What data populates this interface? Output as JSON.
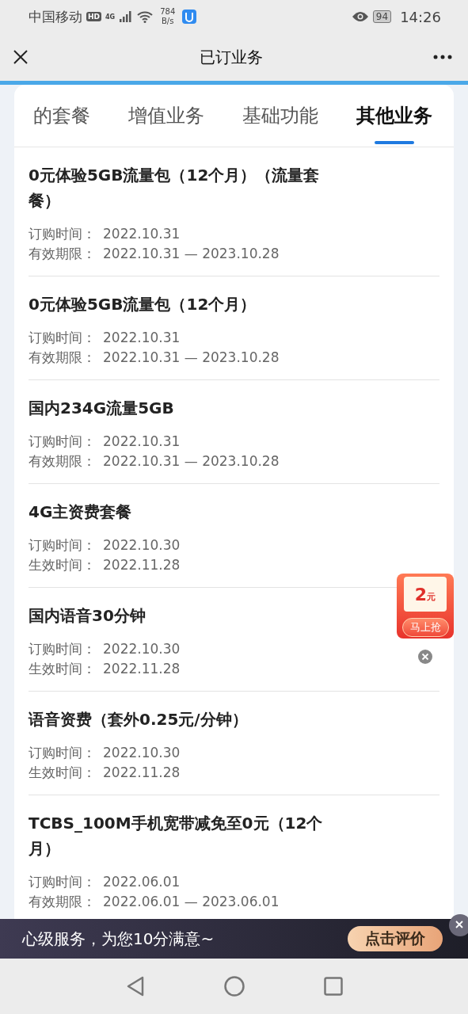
{
  "status_bar": {
    "carrier": "中国移动",
    "hd": "HD",
    "network": "4G",
    "speed_value": "784",
    "speed_unit": "B/s",
    "battery": "94",
    "time": "14:26"
  },
  "header": {
    "title": "已订业务"
  },
  "tabs": [
    {
      "label": "的套餐",
      "selected": false
    },
    {
      "label": "增值业务",
      "selected": false
    },
    {
      "label": "基础功能",
      "selected": false
    },
    {
      "label": "其他业务",
      "selected": true
    }
  ],
  "items": [
    {
      "title": "0元体验5GB流量包（12个月）（流量套餐）",
      "rows": [
        {
          "label": "订购时间：",
          "value": "2022.10.31"
        },
        {
          "label": "有效期限：",
          "value": "2022.10.31 — 2023.10.28"
        }
      ]
    },
    {
      "title": "0元体验5GB流量包（12个月）",
      "rows": [
        {
          "label": "订购时间：",
          "value": "2022.10.31"
        },
        {
          "label": "有效期限：",
          "value": "2022.10.31 — 2023.10.28"
        }
      ]
    },
    {
      "title": "国内234G流量5GB",
      "rows": [
        {
          "label": "订购时间：",
          "value": "2022.10.31"
        },
        {
          "label": "有效期限：",
          "value": "2022.10.31 — 2023.10.28"
        }
      ]
    },
    {
      "title": "4G主资费套餐",
      "rows": [
        {
          "label": "订购时间：",
          "value": "2022.10.30"
        },
        {
          "label": "生效时间：",
          "value": "2022.11.28"
        }
      ]
    },
    {
      "title": "国内语音30分钟",
      "rows": [
        {
          "label": "订购时间：",
          "value": "2022.10.30"
        },
        {
          "label": "生效时间：",
          "value": "2022.11.28"
        }
      ]
    },
    {
      "title": "语音资费（套外0.25元/分钟）",
      "rows": [
        {
          "label": "订购时间：",
          "value": "2022.10.30"
        },
        {
          "label": "生效时间：",
          "value": "2022.11.28"
        }
      ]
    },
    {
      "title": "TCBS_100M手机宽带减免至0元（12个月）",
      "rows": [
        {
          "label": "订购时间：",
          "value": "2022.06.01"
        },
        {
          "label": "有效期限：",
          "value": "2022.06.01 — 2023.06.01"
        }
      ]
    }
  ],
  "coupon": {
    "amount": "2",
    "unit": "元",
    "button": "马上抢"
  },
  "banner": {
    "text": "心级服务，为您10分满意~",
    "button": "点击评价"
  }
}
